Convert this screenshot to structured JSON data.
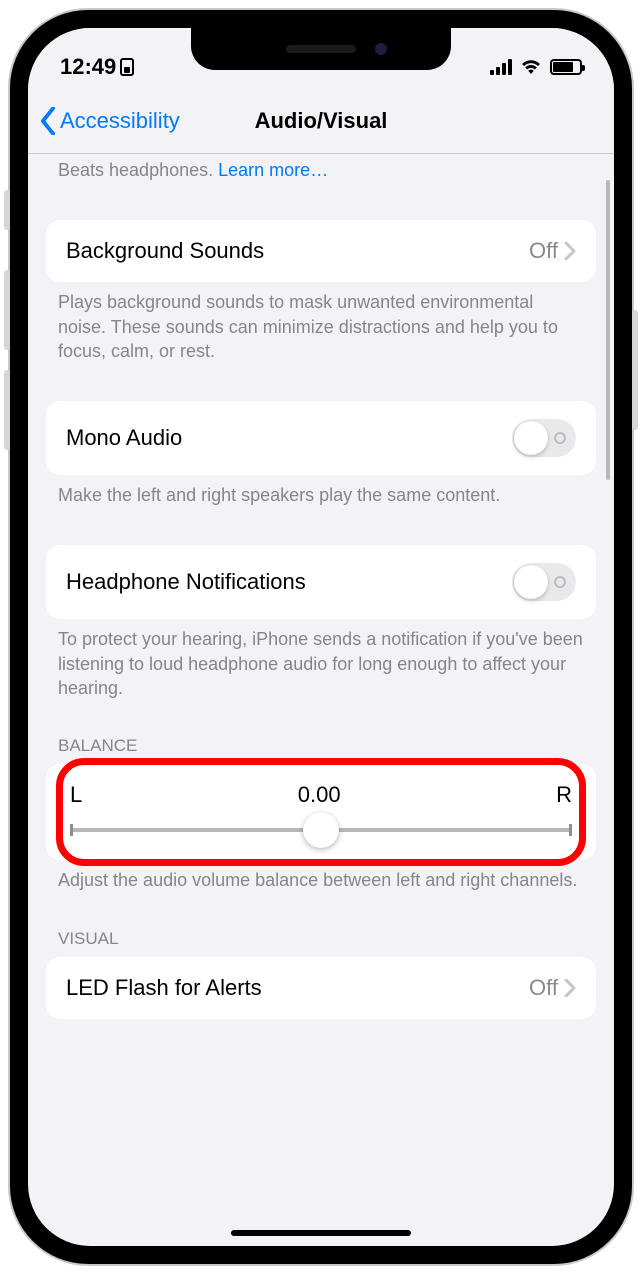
{
  "status": {
    "time": "12:49"
  },
  "nav": {
    "back_label": "Accessibility",
    "title": "Audio/Visual"
  },
  "top_trunc": {
    "prefix": "Beats headphones. ",
    "link": "Learn more…"
  },
  "bg_sounds": {
    "label": "Background Sounds",
    "value": "Off",
    "footer": "Plays background sounds to mask unwanted environmental noise. These sounds can minimize distractions and help you to focus, calm, or rest."
  },
  "mono": {
    "label": "Mono Audio",
    "footer": "Make the left and right speakers play the same content."
  },
  "hp_notif": {
    "label": "Headphone Notifications",
    "footer": "To protect your hearing, iPhone sends a notification if you've been listening to loud headphone audio for long enough to affect your hearing."
  },
  "balance": {
    "header": "BALANCE",
    "left": "L",
    "value": "0.00",
    "right": "R",
    "footer": "Adjust the audio volume balance between left and right channels."
  },
  "visual": {
    "header": "VISUAL",
    "led_label": "LED Flash for Alerts",
    "led_value": "Off"
  }
}
